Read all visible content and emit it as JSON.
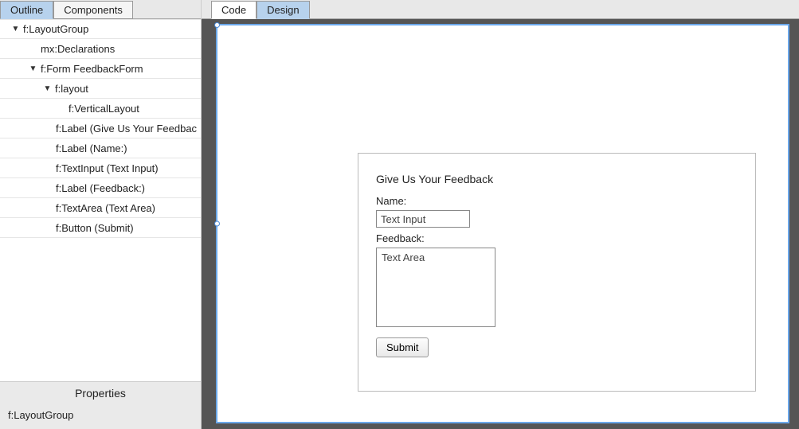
{
  "left": {
    "tabs": {
      "outline": "Outline",
      "components": "Components"
    },
    "tree": {
      "row0": "f:LayoutGroup",
      "row1": "mx:Declarations",
      "row2": "f:Form FeedbackForm",
      "row3": "f:layout",
      "row4": "f:VerticalLayout",
      "row5": "f:Label (Give Us Your Feedbac",
      "row6": "f:Label (Name:)",
      "row7": "f:TextInput (Text Input)",
      "row8": "f:Label (Feedback:)",
      "row9": "f:TextArea (Text Area)",
      "row10": "f:Button (Submit)"
    },
    "properties": {
      "header": "Properties",
      "selected": "f:LayoutGroup"
    }
  },
  "right": {
    "tabs": {
      "code": "Code",
      "design": "Design"
    }
  },
  "form": {
    "title": "Give Us Your Feedback",
    "name_label": "Name:",
    "name_value": "Text Input",
    "feedback_label": "Feedback:",
    "feedback_value": "Text Area",
    "submit_label": "Submit"
  }
}
